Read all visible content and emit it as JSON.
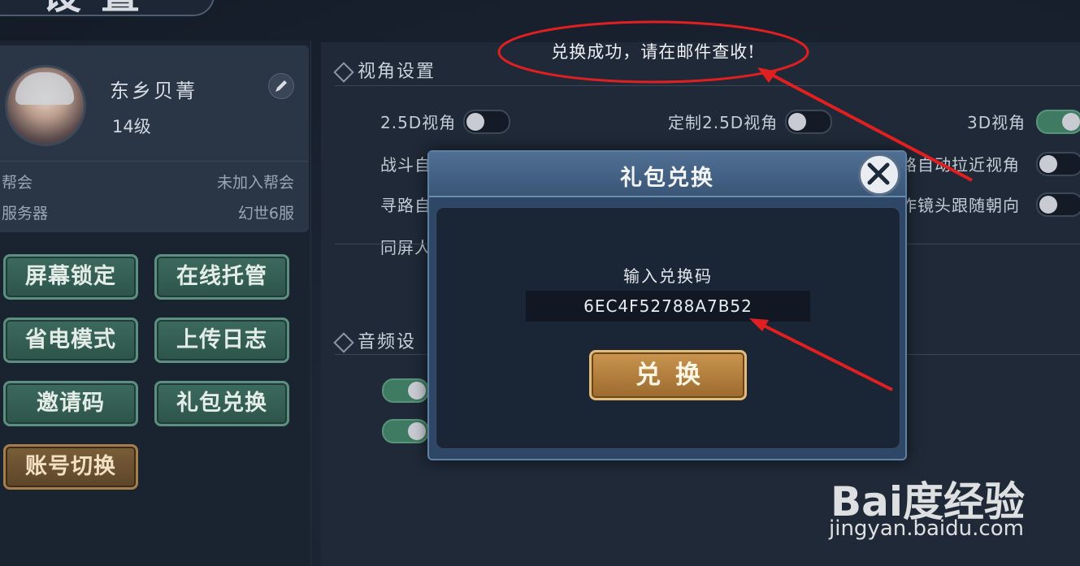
{
  "header": {
    "title": "设置"
  },
  "profile": {
    "name": "东乡贝菁",
    "level": "14级",
    "guild_label": "帮会",
    "guild_value": "未加入帮会",
    "server_label": "服务器",
    "server_value": "幻世6服"
  },
  "left_buttons": [
    {
      "label": "屏幕锁定"
    },
    {
      "label": "在线托管"
    },
    {
      "label": "省电模式"
    },
    {
      "label": "上传日志"
    },
    {
      "label": "邀请码"
    },
    {
      "label": "礼包兑换"
    },
    {
      "label": "账号切换"
    }
  ],
  "view_settings": {
    "title": "视角设置",
    "options": [
      {
        "label": "2.5D视角",
        "on": false
      },
      {
        "label": "定制2.5D视角",
        "on": false
      },
      {
        "label": "3D视角",
        "on": true
      },
      {
        "label": "战斗自",
        "on": null
      },
      {
        "label": "路自动拉近视角",
        "on": false
      },
      {
        "label": "寻路自",
        "on": null
      },
      {
        "label": "作镜头跟随朝向",
        "on": false
      },
      {
        "label": "同屏人",
        "on": null
      }
    ]
  },
  "audio_settings": {
    "title": "音频设"
  },
  "dialog": {
    "title": "礼包兑换",
    "code_label": "输入兑换码",
    "code_value": "6EC4F52788A7B52",
    "redeem_label": "兑换"
  },
  "annotation": {
    "notice": "兑换成功，请在邮件查收!"
  },
  "watermark": {
    "logo": "Bai度经验",
    "url": "jingyan.baidu.com"
  },
  "colors": {
    "accent_green": "#3f7a62",
    "gold_button": "#c9954f",
    "annotation_red": "#e02020"
  }
}
